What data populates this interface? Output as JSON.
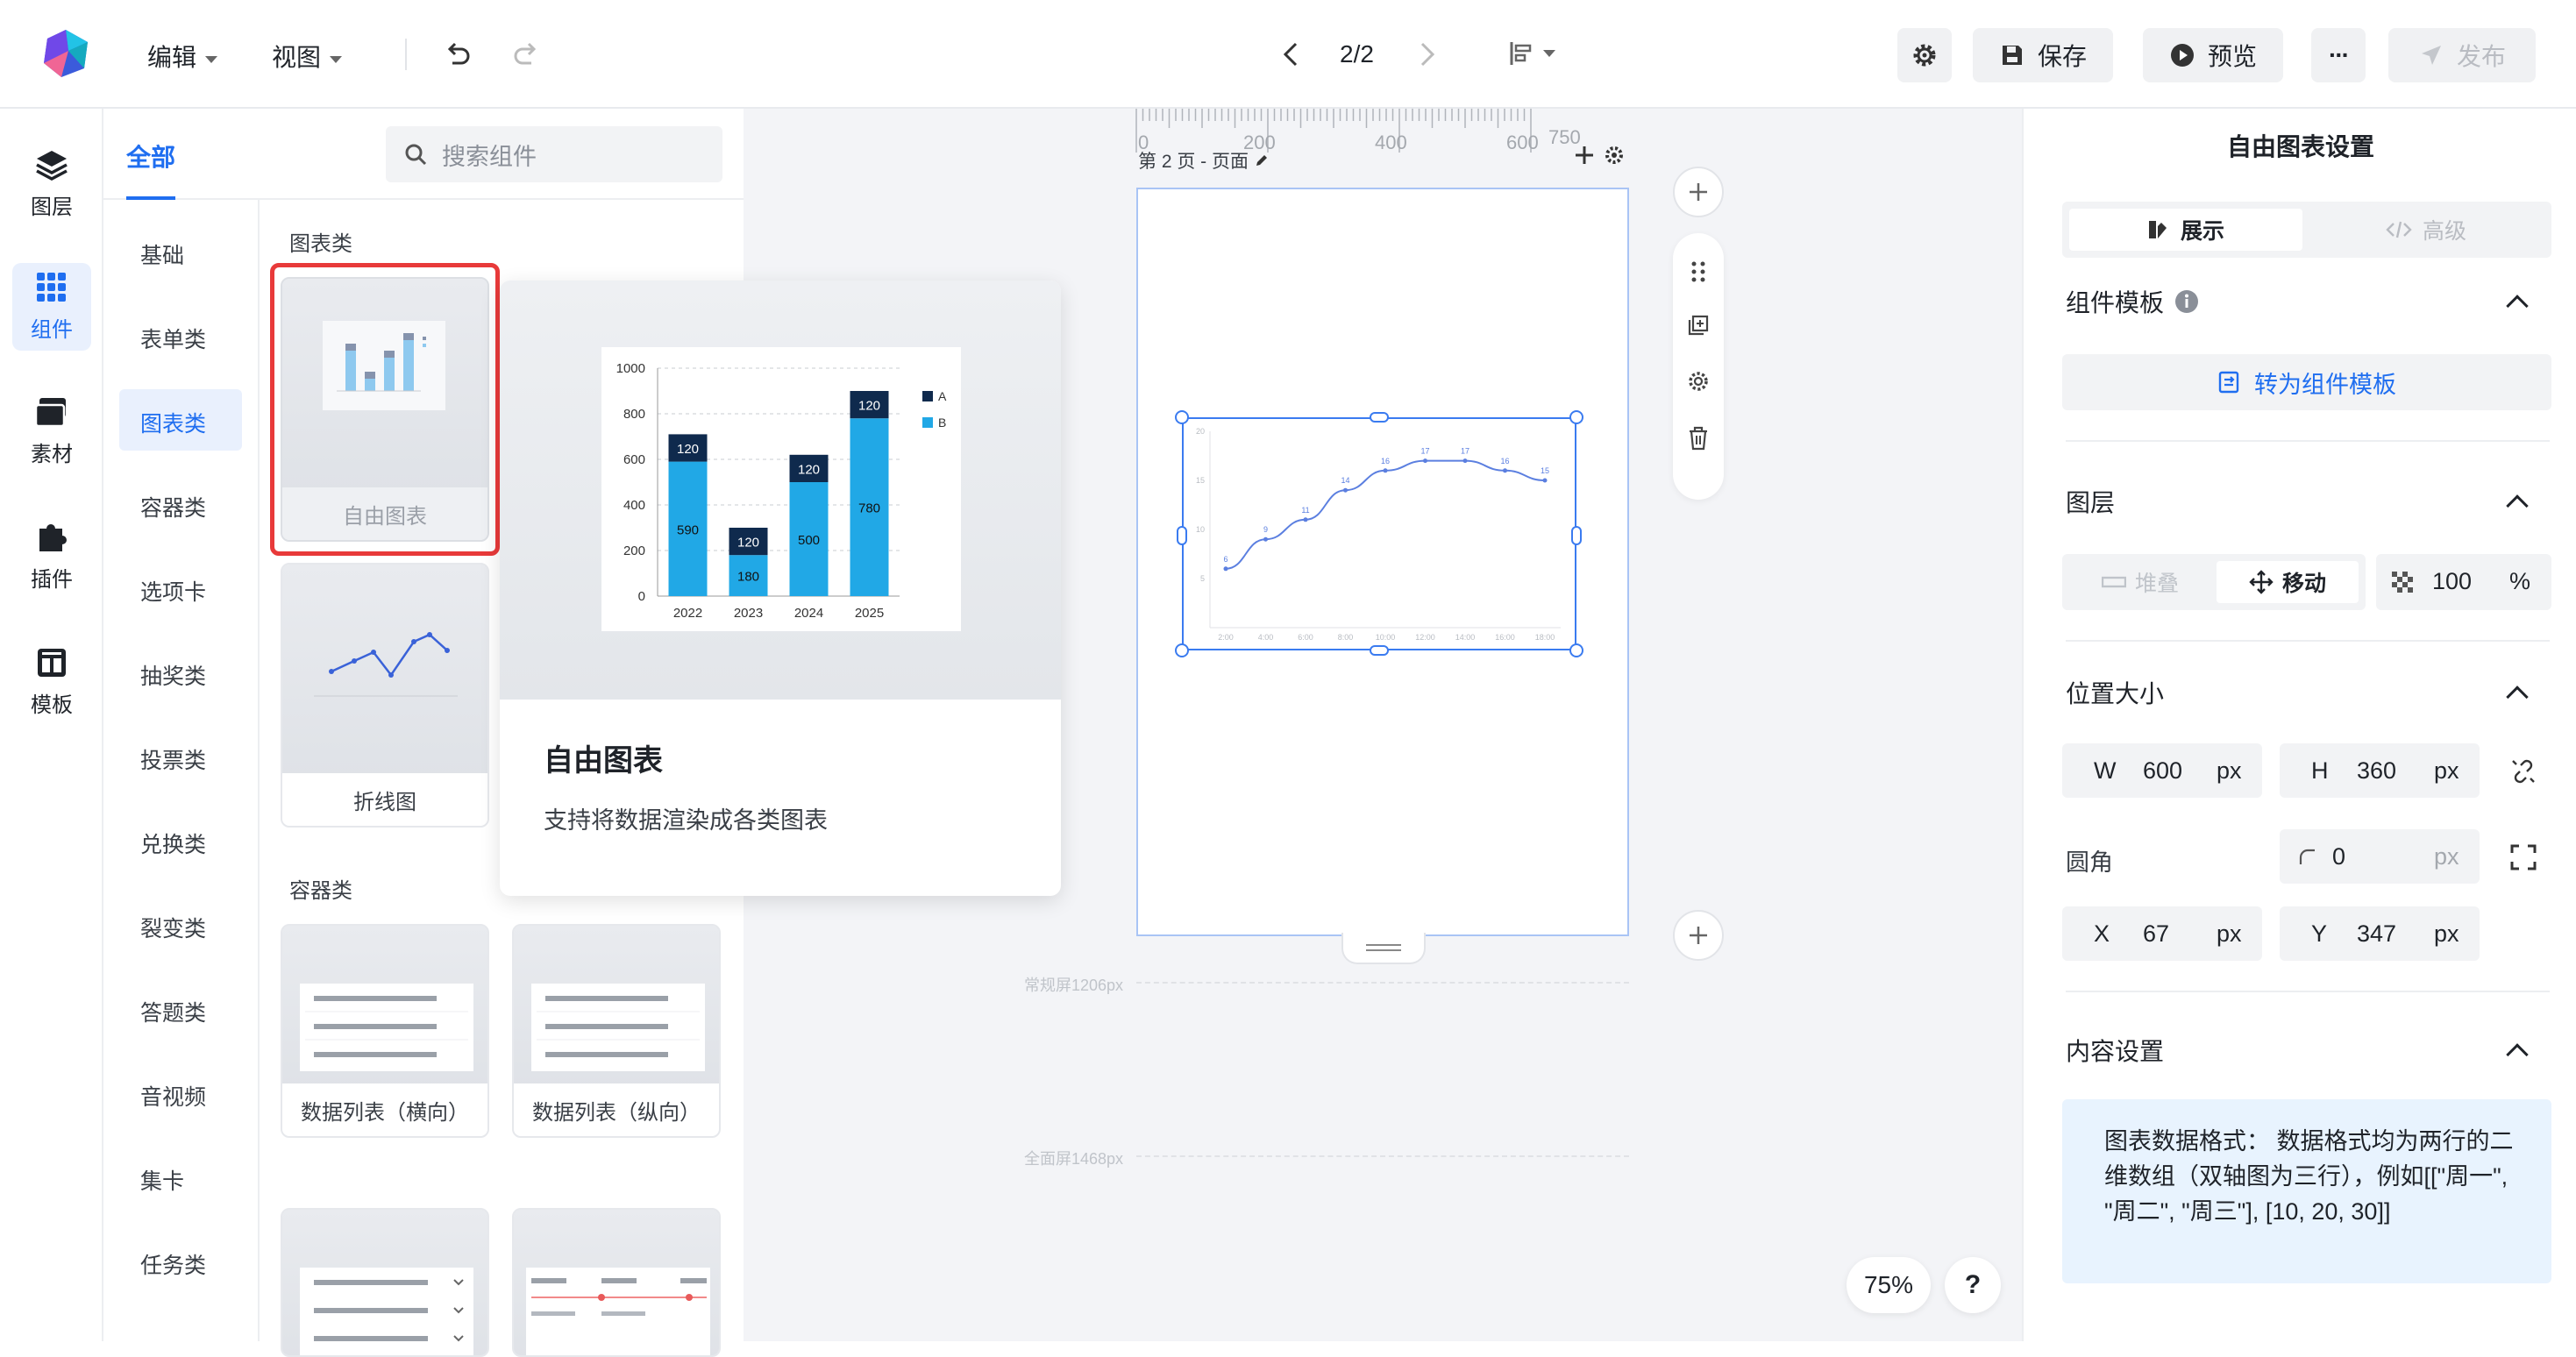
{
  "topbar": {
    "menu_edit": "编辑",
    "menu_view": "视图",
    "page_indicator": "2/2",
    "save_label": "保存",
    "preview_label": "预览",
    "more_label": "···",
    "publish_label": "发布"
  },
  "rail": {
    "items": [
      {
        "label": "图层",
        "icon": "layers-icon"
      },
      {
        "label": "组件",
        "icon": "grid-icon"
      },
      {
        "label": "素材",
        "icon": "folder-icon"
      },
      {
        "label": "插件",
        "icon": "puzzle-icon"
      },
      {
        "label": "模板",
        "icon": "template-icon"
      }
    ]
  },
  "panel": {
    "tab_all": "全部",
    "search_placeholder": "搜索组件",
    "categories": [
      "基础",
      "表单类",
      "图表类",
      "容器类",
      "选项卡",
      "抽奖类",
      "投票类",
      "兑换类",
      "裂变类",
      "答题类",
      "音视频",
      "集卡",
      "任务类"
    ],
    "section_chart": "图表类",
    "section_container": "容器类",
    "card_free_chart": "自由图表",
    "card_line_chart": "折线图",
    "card_list_h": "数据列表（横向）",
    "card_list_v": "数据列表（纵向）"
  },
  "popover": {
    "title": "自由图表",
    "desc": "支持将数据渲染成各类图表"
  },
  "preview_chart_data": {
    "type": "bar",
    "categories": [
      "2022",
      "2023",
      "2024",
      "2025"
    ],
    "series": [
      {
        "name": "B",
        "values": [
          590,
          180,
          500,
          780
        ]
      },
      {
        "name": "A",
        "values": [
          120,
          120,
          120,
          120
        ]
      }
    ],
    "ylim": [
      0,
      1000
    ],
    "yticks": [
      "1000",
      "800",
      "600",
      "400",
      "200",
      "0"
    ],
    "colors": {
      "A": "#0f2a4d",
      "B": "#21a8e6"
    }
  },
  "canvas": {
    "ruler_labels": [
      "0",
      "200",
      "400",
      "600",
      "750"
    ],
    "page_label": "第 2 页 - 页面",
    "guide_normal": "常规屏1206px",
    "guide_full": "全面屏1468px",
    "zoom": "75%",
    "help": "?"
  },
  "canvas_chart_data": {
    "type": "line",
    "x": [
      "2:00",
      "4:00",
      "6:00",
      "8:00",
      "10:00",
      "12:00",
      "14:00",
      "16:00",
      "18:00"
    ],
    "y_labels": [
      "6",
      "9",
      "11",
      "14",
      "16",
      "17",
      "17",
      "16",
      "15"
    ],
    "y_axis_ticks": [
      "20",
      "15",
      "10",
      "5"
    ]
  },
  "right": {
    "title": "自由图表设置",
    "tab_show": "展示",
    "tab_advanced": "高级",
    "template_section": "组件模板",
    "convert_btn": "转为组件模板",
    "layer_section": "图层",
    "stack_label": "堆叠",
    "move_label": "移动",
    "opacity": "100",
    "percent": "%",
    "pos_section": "位置大小",
    "w_label": "W",
    "w_value": "600",
    "h_label": "H",
    "h_value": "360",
    "unit": "px",
    "radius_label": "圆角",
    "radius_value": "0",
    "x_label": "X",
    "x_value": "67",
    "y_label": "Y",
    "y_value": "347",
    "content_section": "内容设置",
    "content_note": "图表数据格式： 数据格式均为两行的二维数组（双轴图为三行），例如[[\"周一\", \"周二\", \"周三\"], [10, 20, 30]]"
  }
}
